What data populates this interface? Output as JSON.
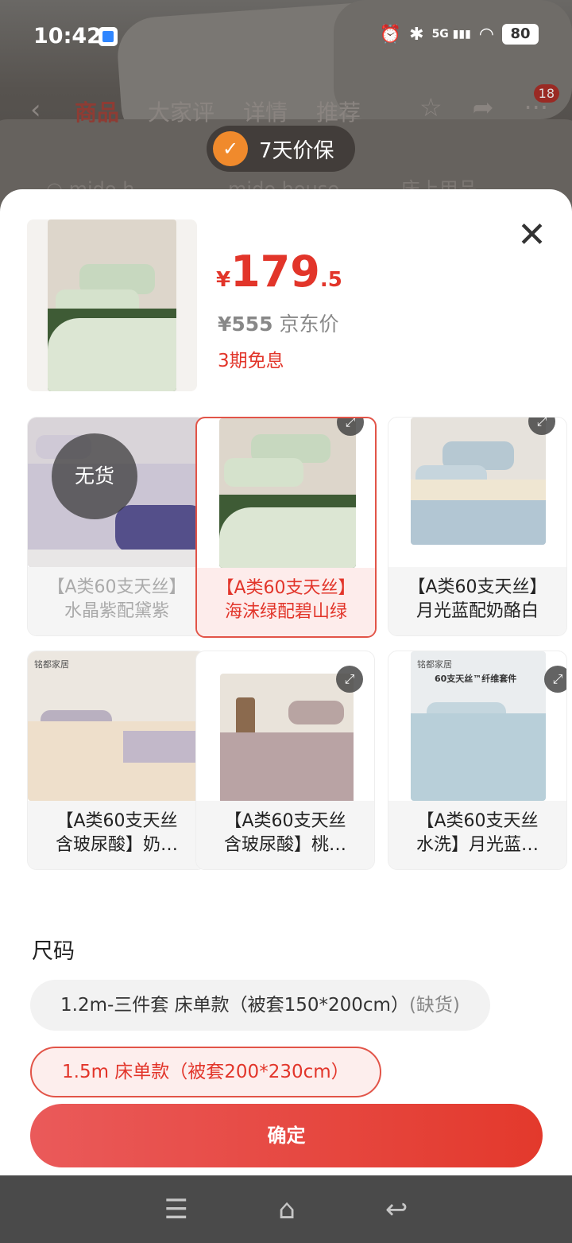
{
  "status_bar": {
    "time": "10:42",
    "signal": "5G",
    "battery": "80",
    "icons": [
      "alarm-icon",
      "bluetooth-icon",
      "signal-icon",
      "wifi-icon"
    ]
  },
  "background_page": {
    "tabs": [
      "商品",
      "大家评",
      "详情",
      "推荐"
    ],
    "active_tab": "商品",
    "badge": "18",
    "search_text": "mido h",
    "search_text2": "mido house",
    "search_text3": "床上用品"
  },
  "price_guarantee": {
    "label": "7天价保"
  },
  "product": {
    "yen": "¥",
    "price_int": "179",
    "price_dec": ".5",
    "old_price": "¥555",
    "old_price_label": "京东价",
    "installment": "3期免息"
  },
  "variants": [
    {
      "line1": "【A类60支天丝】",
      "line2": "水晶紫配黛紫",
      "state": "disabled",
      "badge": "无货"
    },
    {
      "line1": "【A类60支天丝】",
      "line2": "海沫绿配碧山绿",
      "state": "selected"
    },
    {
      "line1": "【A类60支天丝】",
      "line2": "月光蓝配奶酪白",
      "state": "normal"
    },
    {
      "line1": "【A类60支天丝",
      "line2": "含玻尿酸】奶…",
      "state": "normal",
      "brand": "铭都家居"
    },
    {
      "line1": "【A类60支天丝",
      "line2": "含玻尿酸】桃…",
      "state": "normal"
    },
    {
      "line1": "【A类60支天丝",
      "line2": "水洗】月光蓝…",
      "state": "normal",
      "brand": "铭都家居",
      "promo": "60支天丝™纤维套件"
    }
  ],
  "size": {
    "title": "尺码",
    "options": [
      {
        "label": "1.2m-三件套 床单款（被套150*200cm）",
        "note": "(缺货)",
        "state": "out_of_stock"
      },
      {
        "label": "1.5m 床单款（被套200*230cm）",
        "state": "selected"
      }
    ]
  },
  "confirm_label": "确定",
  "colors": {
    "accent": "#e2352a",
    "button_start": "#ea5a5a",
    "button_end": "#e3392c",
    "selected_bg": "#fdeceb"
  }
}
